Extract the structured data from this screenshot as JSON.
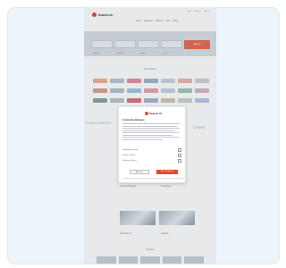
{
  "brand": {
    "logo_text": "Search.ch",
    "accent": "#e9452b"
  },
  "toplinks": [
    "Login",
    "Deutsch",
    "Suche"
  ],
  "nav": [
    "Autos",
    "Motorrad",
    "Wohnen",
    "Jobs",
    "Mehr"
  ],
  "search": {
    "fields": [
      "Marke",
      "Modell",
      "Preis",
      "Ort"
    ],
    "button_label": "Suchen"
  },
  "brands_title": "Top-Marken",
  "brand_colors": [
    "#f3b08c",
    "#b9c8d8",
    "#e88c9a",
    "#9fb4d2",
    "#c9d4e2",
    "#e9b7a3",
    "#cbd2da",
    "#d9a28f",
    "#b8c2cc",
    "#9ec9e4",
    "#e3a7b2",
    "#c7d3df",
    "#a8c8b2",
    "#d7b7c4",
    "#88a3a0",
    "#bac4cf",
    "#e06f7c",
    "#a6b7ca",
    "#d7c2b0",
    "#c7d5c5",
    "#b6c7e3"
  ],
  "promo_left": "Autos kaufen",
  "promo_right": "CHEM",
  "cards": [
    "Gebrauchtwagen",
    "Neuwagen",
    "Occasionen",
    "Leasing"
  ],
  "footer_title": "Partner",
  "modal": {
    "logo_text": "Search.ch",
    "title": "Cookie-Einstellungen",
    "rows": [
      "Notwendige Cookies",
      "Statistik-Cookies",
      "Marketing-Cookies"
    ],
    "decline_label": "Ablehnen",
    "accept_label": "Alle akzeptieren"
  }
}
